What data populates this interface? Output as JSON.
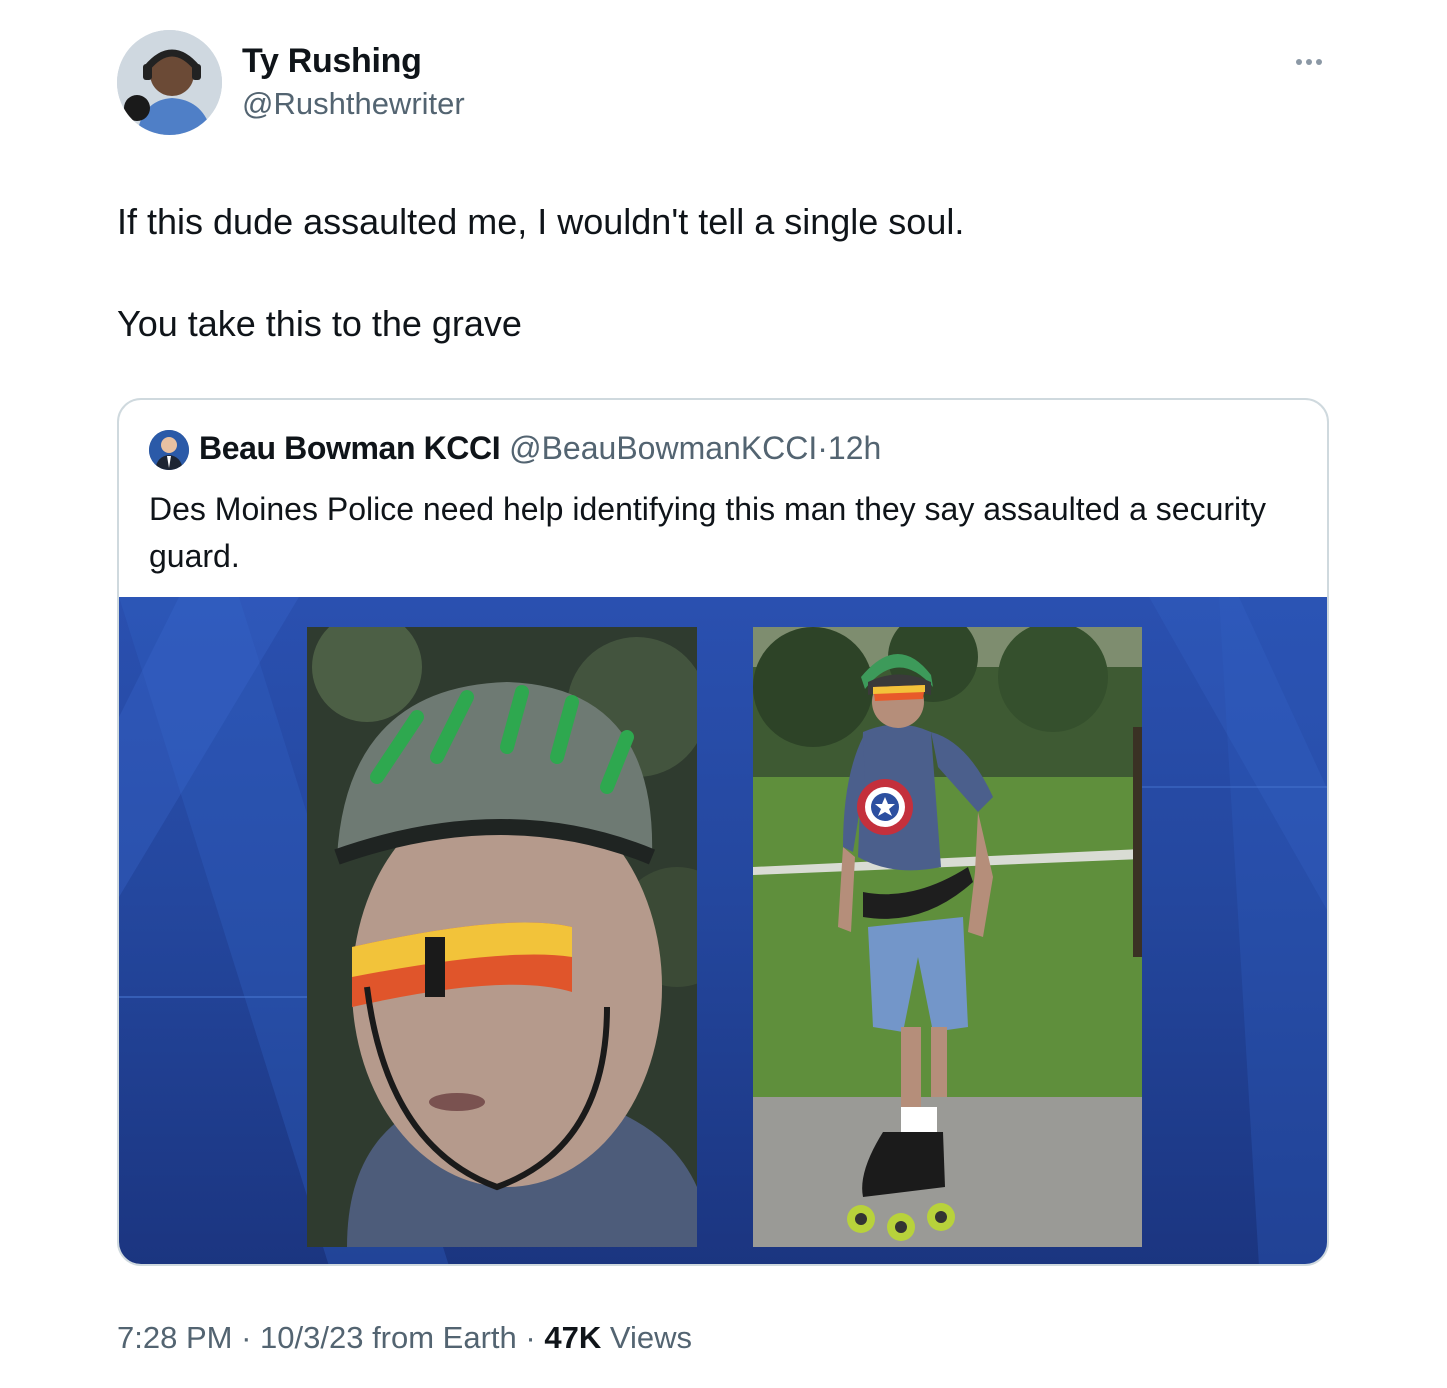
{
  "tweet": {
    "author_name": "Ty Rushing",
    "author_handle": "@Rushthewriter",
    "text_line1": "If this dude assaulted me, I wouldn't tell a single soul.",
    "text_line2": "You take this to the grave",
    "more_icon": "more-horizontal-icon"
  },
  "quoted_tweet": {
    "author_name": "Beau Bowman KCCI",
    "author_handle": "@BeauBowmanKCCI",
    "separator": "·",
    "time": "12h",
    "text": "Des Moines Police need help identifying this man they say assaulted a security guard."
  },
  "meta": {
    "time": "7:28 PM",
    "sep1": " · ",
    "date": "10/3/23",
    "source": " from Earth",
    "sep2": " · ",
    "views_count": "47K",
    "views_label": " Views"
  },
  "colors": {
    "text_primary": "#0f1419",
    "text_secondary": "#536471",
    "border": "#cfd9de",
    "media_background": "#24479e"
  }
}
